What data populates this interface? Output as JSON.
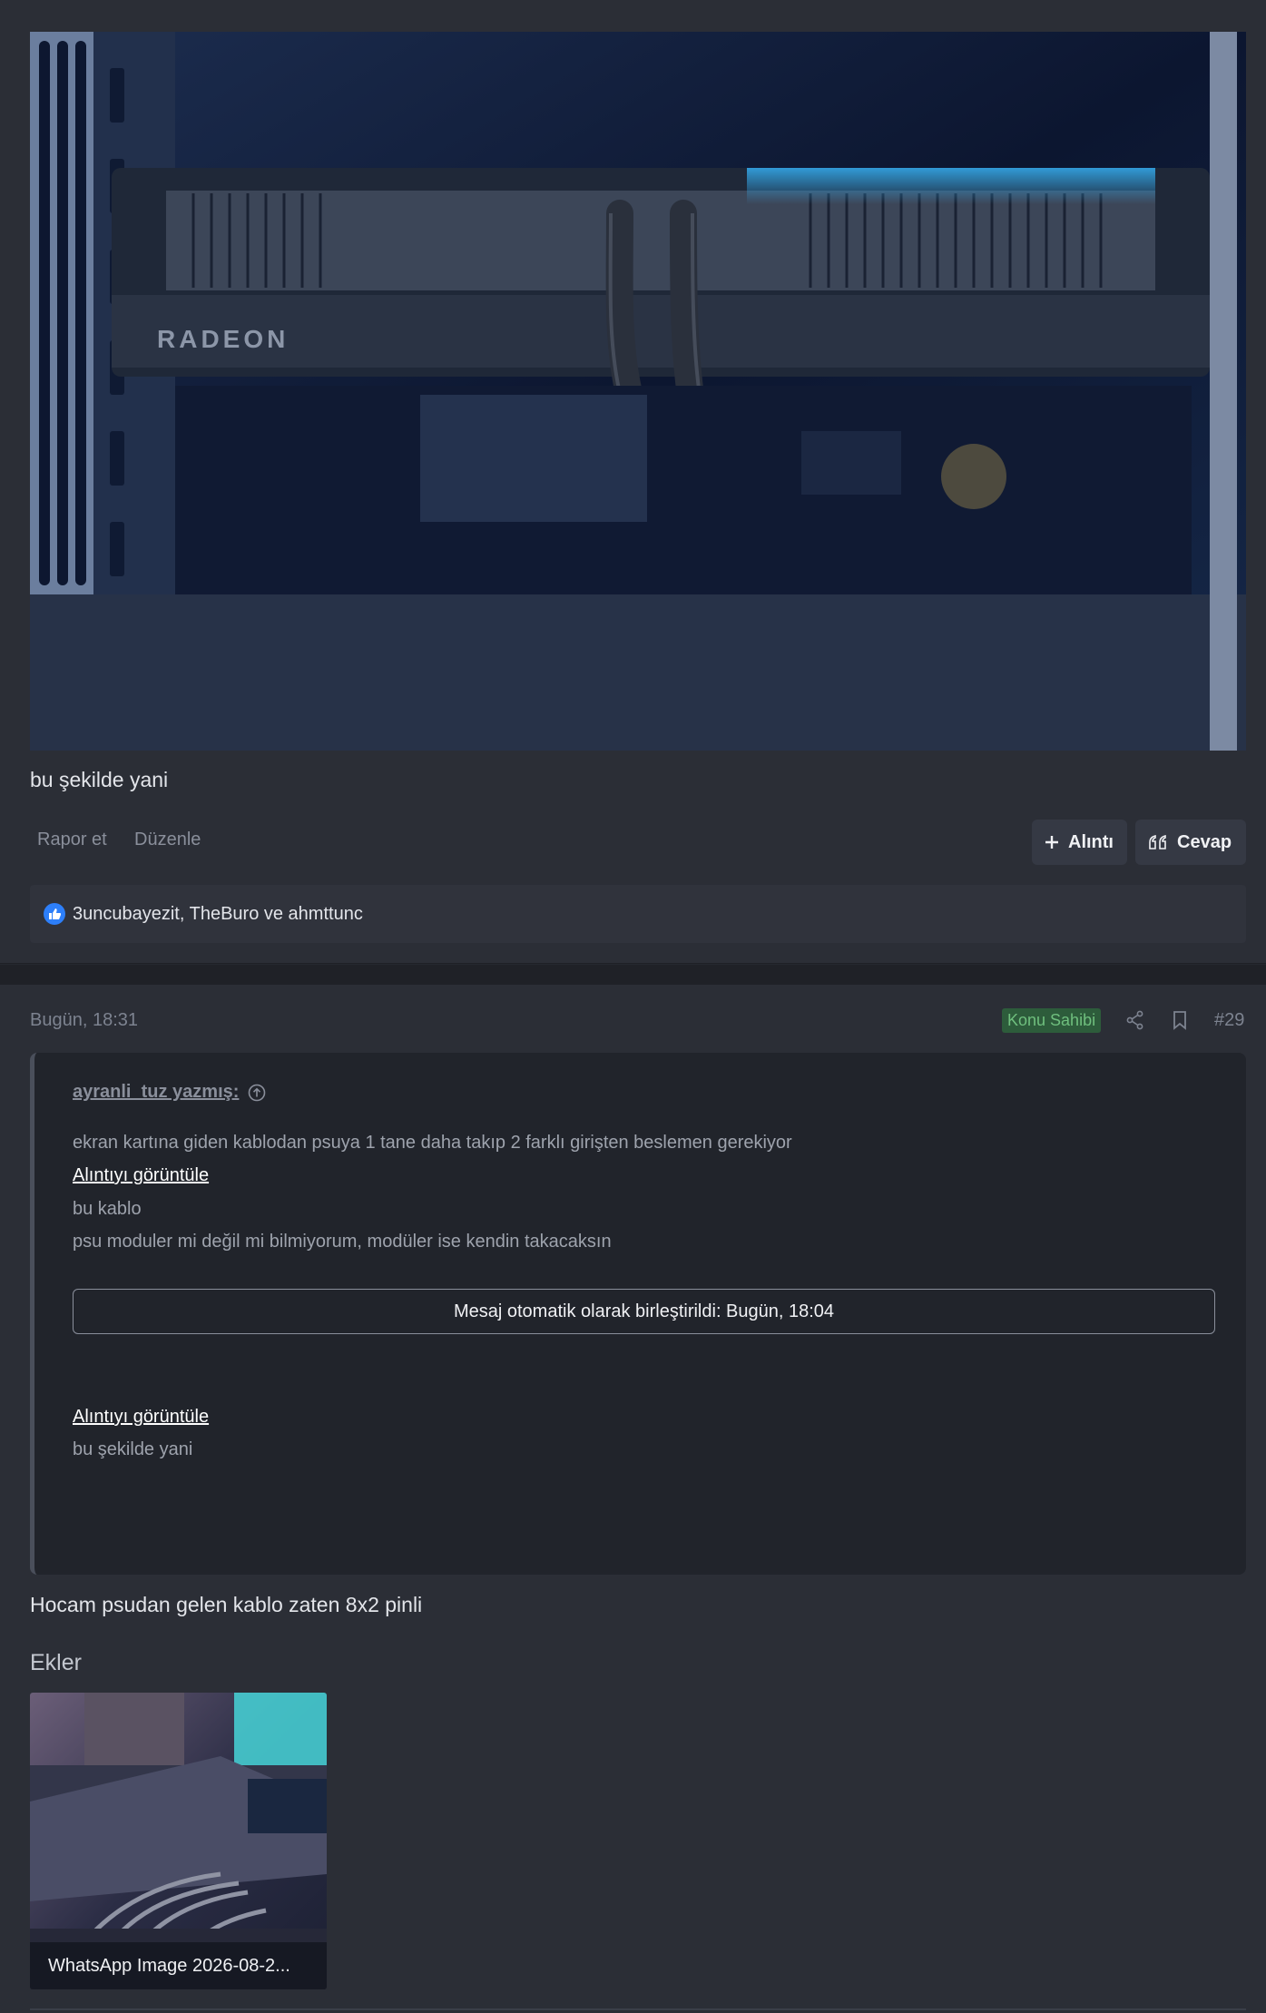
{
  "post1": {
    "text": "bu şekilde yani",
    "photo_brand": "RADEON",
    "actions": {
      "report": "Rapor et",
      "edit": "Düzenle"
    },
    "buttons": {
      "quote": "Alıntı",
      "reply": "Cevap"
    },
    "reactions": "3uncubayezit, TheBuro ve ahmttunc"
  },
  "post2": {
    "date": "Bugün, 18:31",
    "badge": "Konu Sahibi",
    "number": "#29",
    "quote": {
      "author": "ayranli_tuz yazmış:",
      "line1": "ekran kartına giden kablodan psuya 1 tane daha takıp 2 farklı girişten beslemen gerekiyor",
      "view_link_1": "Alıntıyı görüntüle",
      "line2": "bu kablo",
      "line3": "psu moduler mi değil mi bilmiyorum, modüler ise kendin takacaksın",
      "merge_notice": "Mesaj otomatik olarak birleştirildi: Bugün, 18:04",
      "view_link_2": "Alıntıyı görüntüle",
      "line4": "bu şekilde yani"
    },
    "text": "Hocam psudan gelen kablo zaten 8x2 pinli",
    "attachments_title": "Ekler",
    "attachment_name": "WhatsApp Image 2026-08-2..."
  },
  "colors": {
    "accent_like": "#2d7ff9",
    "badge_bg": "#2d5c3b",
    "badge_text": "#6fbf7e"
  }
}
